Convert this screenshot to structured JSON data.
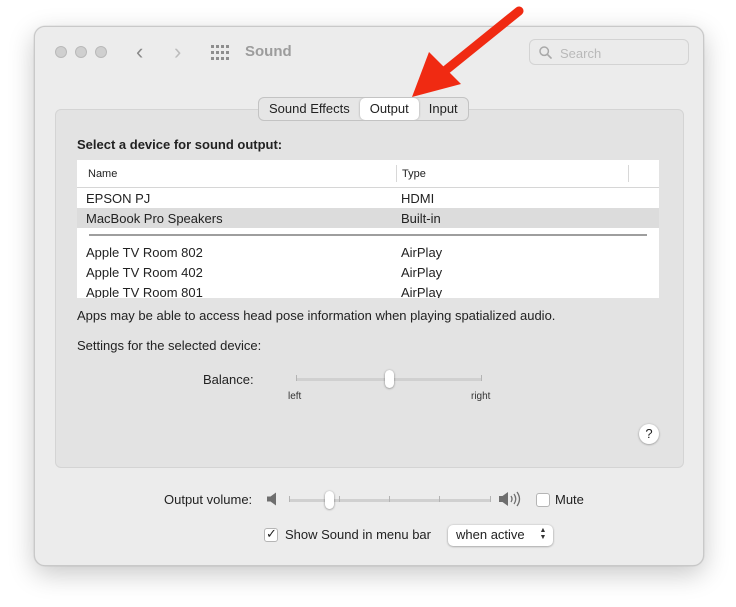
{
  "window": {
    "title": "Sound"
  },
  "search": {
    "placeholder": "Search"
  },
  "tabs": [
    {
      "label": "Sound Effects",
      "active": false
    },
    {
      "label": "Output",
      "active": true
    },
    {
      "label": "Input",
      "active": false
    }
  ],
  "output": {
    "heading": "Select a device for sound output:",
    "columns": {
      "name": "Name",
      "type": "Type"
    },
    "devices_wired": [
      {
        "name": "EPSON PJ",
        "type": "HDMI",
        "selected": false
      },
      {
        "name": "MacBook Pro Speakers",
        "type": "Built-in",
        "selected": true
      }
    ],
    "devices_airplay": [
      {
        "name": "Apple TV Room 802",
        "type": "AirPlay"
      },
      {
        "name": "Apple TV Room 402",
        "type": "AirPlay"
      },
      {
        "name": "Apple TV Room 801",
        "type": "AirPlay"
      }
    ],
    "spatial_note": "Apps may be able to access head pose information when playing spatialized audio.",
    "settings_label": "Settings for the selected device:",
    "balance": {
      "label": "Balance:",
      "left_label": "left",
      "right_label": "right",
      "value": 0.5
    },
    "help_label": "?"
  },
  "volume": {
    "label": "Output volume:",
    "value": 0.2,
    "mute_label": "Mute",
    "muted": false
  },
  "menu_bar": {
    "label": "Show Sound in menu bar",
    "checked": true,
    "select_value": "when active"
  },
  "colors": {
    "annotation_arrow": "#f02a12"
  }
}
